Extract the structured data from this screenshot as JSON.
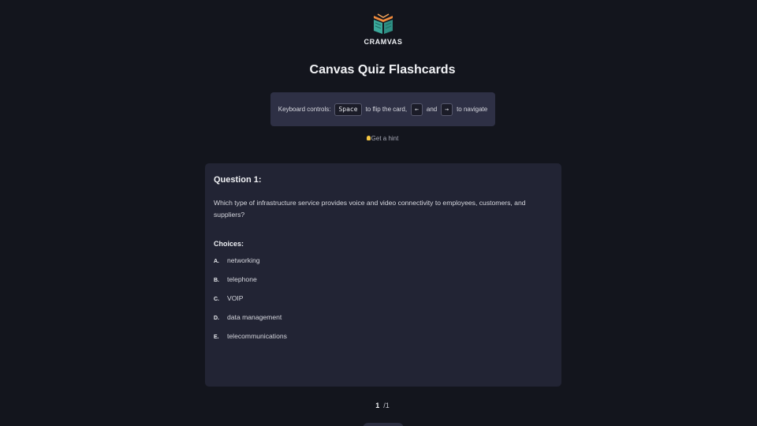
{
  "logo": {
    "text": "CRAMVAS",
    "icon": "open-book-icon"
  },
  "title": "Canvas Quiz Flashcards",
  "keyboard": {
    "prefix": "Keyboard controls:",
    "space_key": "Space",
    "flip_text": "to flip the card,",
    "left_key": "←",
    "and_text": "and",
    "right_key": "→",
    "nav_text": "to navigate"
  },
  "hint": {
    "icon": "lightbulb-icon",
    "label": "Get a hint"
  },
  "card": {
    "question_label": "Question 1:",
    "question_text": "Which type of infrastructure service provides voice and video connectivity to employees, customers, and suppliers?",
    "choices_label": "Choices:",
    "choices": [
      {
        "letter": "A.",
        "text": "networking"
      },
      {
        "letter": "B.",
        "text": "telephone"
      },
      {
        "letter": "C.",
        "text": "VOIP"
      },
      {
        "letter": "D.",
        "text": "data management"
      },
      {
        "letter": "E.",
        "text": "telecommunications"
      }
    ]
  },
  "pager": {
    "current": "1",
    "total": "/1"
  },
  "colors": {
    "background": "#13151d",
    "card": "#222434",
    "panel": "#2e3045"
  }
}
